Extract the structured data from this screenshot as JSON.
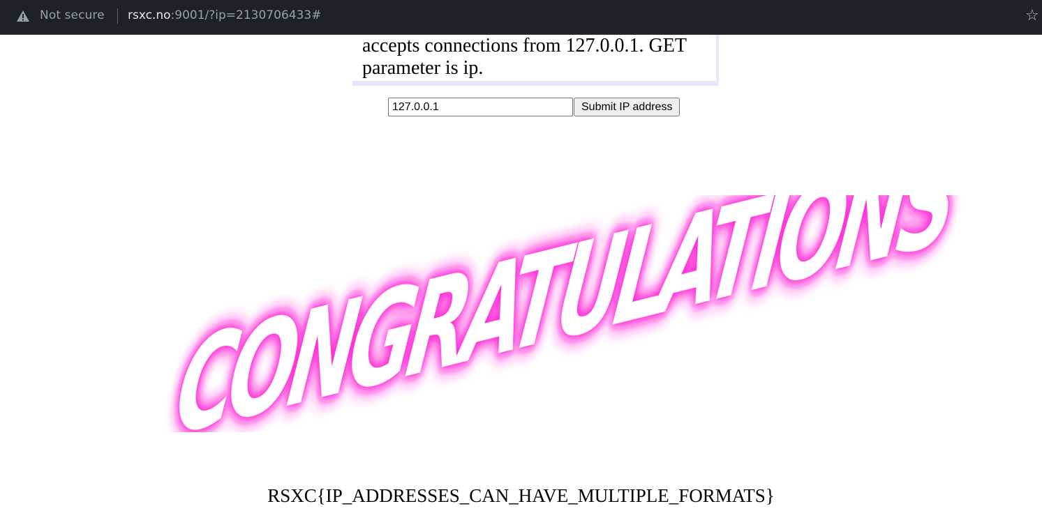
{
  "browser": {
    "security_label": "Not secure",
    "url_host": "rsxc.no",
    "url_rest": ":9001/?ip=2130706433#",
    "warning_icon": "warning-triangle-icon",
    "bookmark_icon": "star-icon"
  },
  "info": {
    "text_line1": "accepts connections from 127.0.0.1. GET",
    "text_line2": "parameter is ip."
  },
  "form": {
    "ip_value": "127.0.0.1",
    "submit_label": "Submit IP address"
  },
  "banner": {
    "text": "CONGRATULATIONS",
    "glow_color": "#ff2bd6",
    "fill_color": "#ffffff"
  },
  "flag": {
    "text": "RSXC{IP_ADDRESSES_CAN_HAVE_MULTIPLE_FORMATS}"
  }
}
